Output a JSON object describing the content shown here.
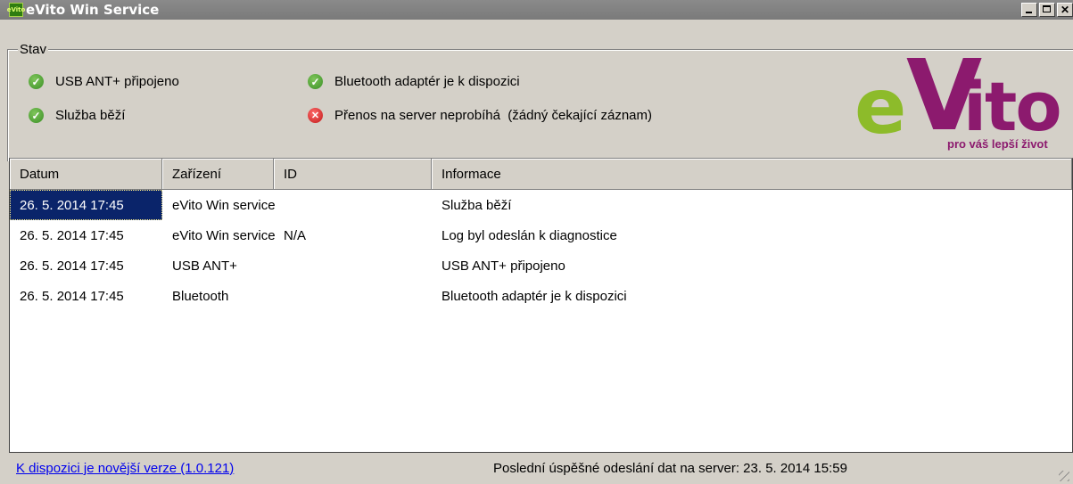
{
  "window": {
    "title": "eVito Win Service",
    "app_icon_text": "eVito"
  },
  "status_group": {
    "label": "Stav",
    "items": [
      {
        "text": "USB ANT+ připojeno",
        "state": "ok"
      },
      {
        "text": "Bluetooth adaptér je k dispozici",
        "state": "ok"
      },
      {
        "text": "Služba běží",
        "state": "ok"
      },
      {
        "text": "Přenos na server neprobíhá  (žádný čekající záznam)",
        "state": "error"
      }
    ]
  },
  "logo": {
    "e": "e",
    "v": "V",
    "ito": "ito",
    "tagline": "pro váš lepší život"
  },
  "log_table": {
    "columns": [
      "Datum",
      "Zařízení",
      "ID",
      "Informace"
    ],
    "rows": [
      [
        "26. 5. 2014 17:45",
        "eVito Win service",
        "",
        "Služba běží"
      ],
      [
        "26. 5. 2014 17:45",
        "eVito Win service",
        "N/A",
        "Log byl odeslán k diagnostice"
      ],
      [
        "26. 5. 2014 17:45",
        "USB ANT+",
        "",
        "USB ANT+ připojeno"
      ],
      [
        "26. 5. 2014 17:45",
        "Bluetooth",
        "",
        "Bluetooth adaptér je k dispozici"
      ]
    ],
    "selected_row": 0
  },
  "footer": {
    "update_link": "K dispozici je novější verze (1.0.121)",
    "last_sent": "Poslední úspěšné odeslání dat na server: 23. 5. 2014 15:59"
  },
  "colors": {
    "brand_green": "#8dbb2a",
    "brand_purple": "#8c1a6e",
    "selection": "#0a246a"
  }
}
